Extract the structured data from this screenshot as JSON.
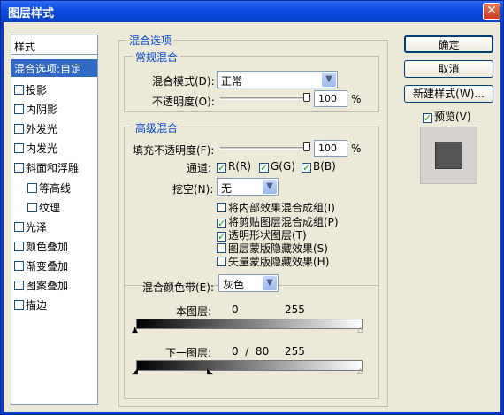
{
  "window": {
    "title": "图层样式",
    "close_symbol": "✕"
  },
  "styles_list": {
    "header": "样式",
    "items": [
      {
        "label": "混合选项:自定",
        "checkbox": false,
        "selected": true,
        "indent": false
      },
      {
        "label": "投影",
        "checkbox": true,
        "checked": false
      },
      {
        "label": "内阴影",
        "checkbox": true,
        "checked": false
      },
      {
        "label": "外发光",
        "checkbox": true,
        "checked": false
      },
      {
        "label": "内发光",
        "checkbox": true,
        "checked": false
      },
      {
        "label": "斜面和浮雕",
        "checkbox": true,
        "checked": false
      },
      {
        "label": "等高线",
        "checkbox": true,
        "checked": false,
        "indent": true
      },
      {
        "label": "纹理",
        "checkbox": true,
        "checked": false,
        "indent": true
      },
      {
        "label": "光泽",
        "checkbox": true,
        "checked": false
      },
      {
        "label": "颜色叠加",
        "checkbox": true,
        "checked": false
      },
      {
        "label": "渐变叠加",
        "checkbox": true,
        "checked": false
      },
      {
        "label": "图案叠加",
        "checkbox": true,
        "checked": false
      },
      {
        "label": "描边",
        "checkbox": true,
        "checked": false
      }
    ]
  },
  "blend_options": {
    "title": "混合选项",
    "general": {
      "title": "常规混合",
      "mode_label": "混合模式(D):",
      "mode_value": "正常",
      "opacity_label": "不透明度(O):",
      "opacity_value": "100",
      "opacity_unit": "%"
    },
    "advanced": {
      "title": "高级混合",
      "fill_label": "填充不透明度(F):",
      "fill_value": "100",
      "fill_unit": "%",
      "channels_label": "通道:",
      "channels": [
        "R(R)",
        "G(G)",
        "B(B)"
      ],
      "knockout_label": "挖空(N):",
      "knockout_value": "无",
      "options": [
        {
          "label": "将内部效果混合成组(I)",
          "checked": false
        },
        {
          "label": "将剪贴图层混合成组(P)",
          "checked": true
        },
        {
          "label": "透明形状图层(T)",
          "checked": true
        },
        {
          "label": "图层蒙版隐藏效果(S)",
          "checked": false
        },
        {
          "label": "矢量蒙版隐藏效果(H)",
          "checked": false
        }
      ]
    },
    "blend_if": {
      "label": "混合颜色带(E):",
      "value": "灰色",
      "this_layer_label": "本图层:",
      "this_layer_low": "0",
      "this_layer_high": "255",
      "underlying_label": "下一图层:",
      "underlying_values": "0  /  80",
      "underlying_high": "255"
    }
  },
  "buttons": {
    "ok": "确定",
    "cancel": "取消",
    "new_style": "新建样式(W)...",
    "preview": "预览(V)"
  },
  "colors": {
    "accent": "#316ac5",
    "group_title": "#0046d5",
    "titlebar": "#0a4ae0",
    "preview_swatch": "#555555"
  },
  "icons": {
    "close": "close-icon",
    "dropdown": "chevron-down-icon",
    "checkbox": "checkbox-icon"
  }
}
